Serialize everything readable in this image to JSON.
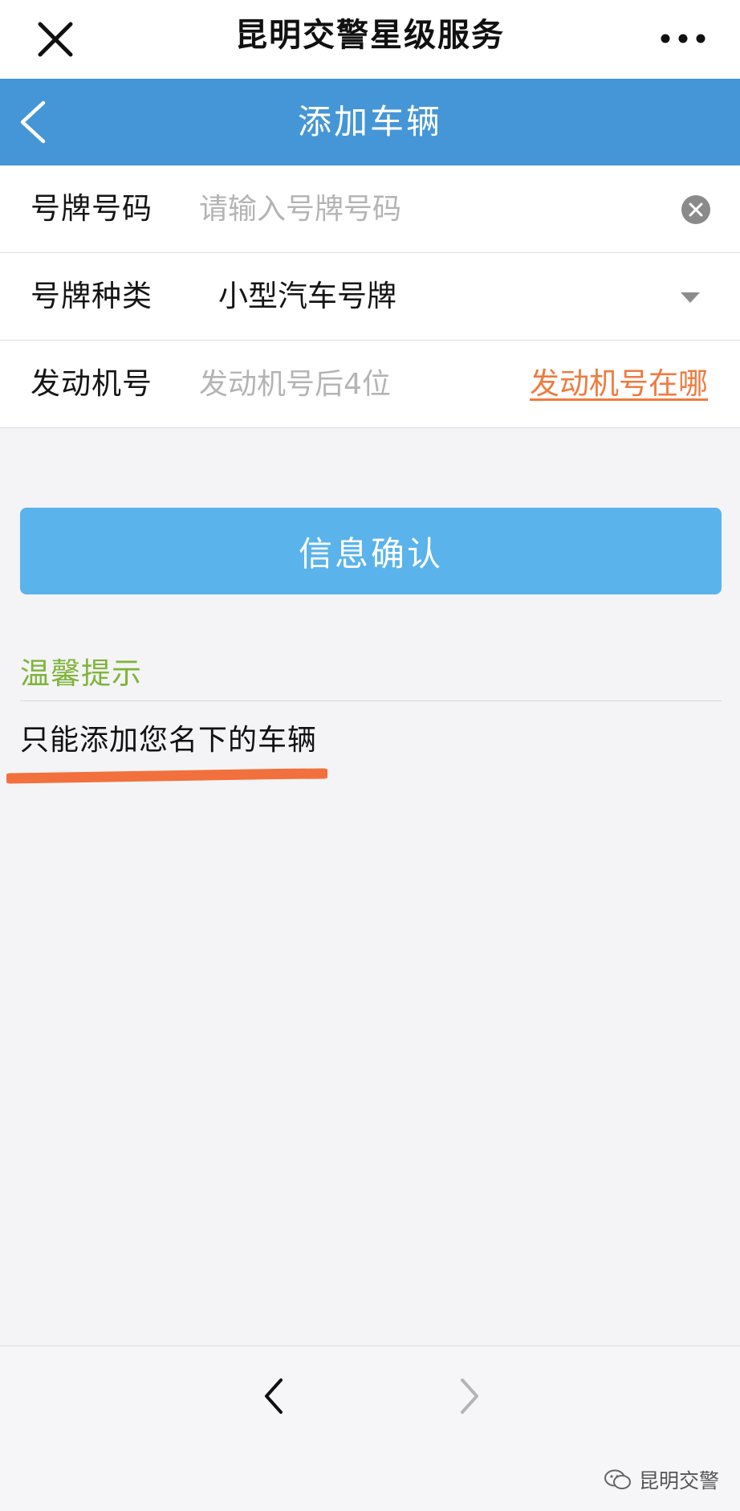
{
  "top_bar": {
    "title": "昆明交警星级服务"
  },
  "nav_bar": {
    "title": "添加车辆"
  },
  "form": {
    "plate_number": {
      "label": "号牌号码",
      "placeholder": "请输入号牌号码",
      "value": ""
    },
    "plate_type": {
      "label": "号牌种类",
      "value": "小型汽车号牌"
    },
    "engine_number": {
      "label": "发动机号",
      "placeholder": "发动机号后4位",
      "help_link": "发动机号在哪"
    }
  },
  "confirm_button": {
    "label": "信息确认"
  },
  "tips": {
    "title": "温馨提示",
    "text": "只能添加您名下的车辆"
  },
  "watermark": {
    "text": "昆明交警"
  },
  "colors": {
    "nav_bar": "#4596d6",
    "button": "#5ab3ea",
    "tips_title": "#7fb43a",
    "link": "#ee7b3f",
    "highlight_stroke": "#f2703d"
  },
  "icons": [
    "close-icon",
    "more-icon",
    "back-arrow-icon",
    "clear-icon",
    "dropdown-caret-icon",
    "nav-back-icon",
    "nav-forward-icon",
    "wechat-icon"
  ]
}
